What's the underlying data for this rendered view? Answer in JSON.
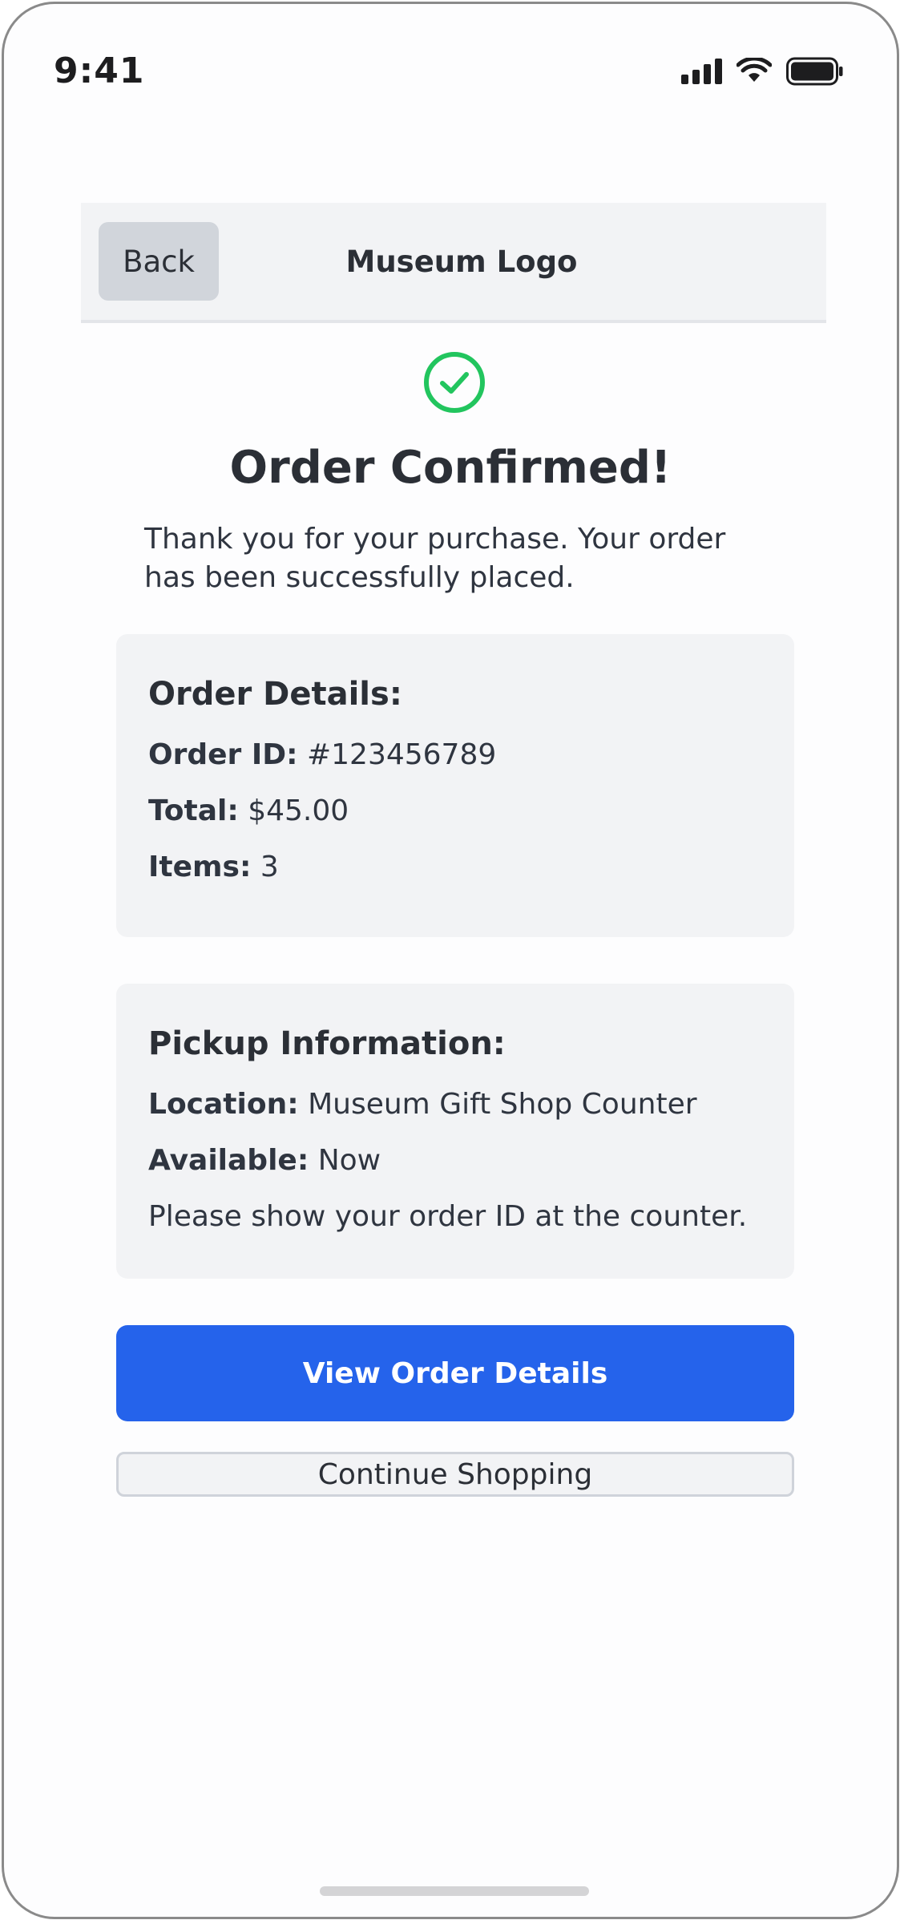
{
  "status_bar": {
    "time": "9:41",
    "icons": [
      "cellular-signal-icon",
      "wifi-icon",
      "battery-icon"
    ]
  },
  "header": {
    "back_label": "Back",
    "logo_text": "Museum Logo"
  },
  "confirmation": {
    "icon": "check-circle-icon",
    "icon_color": "#22c55e",
    "title": "Order Confirmed!",
    "message": "Thank you for your purchase. Your order has been successfully placed."
  },
  "order_details": {
    "heading": "Order Details:",
    "order_id_label": "Order ID:",
    "order_id_value": "#123456789",
    "total_label": "Total:",
    "total_value": "$45.00",
    "items_label": "Items:",
    "items_value": "3"
  },
  "pickup_info": {
    "heading": "Pickup Information:",
    "location_label": "Location:",
    "location_value": "Museum Gift Shop Counter",
    "available_label": "Available:",
    "available_value": "Now",
    "note": "Please show your order ID at the counter."
  },
  "actions": {
    "primary_label": "View Order Details",
    "primary_color": "#2563eb",
    "secondary_label": "Continue Shopping"
  }
}
